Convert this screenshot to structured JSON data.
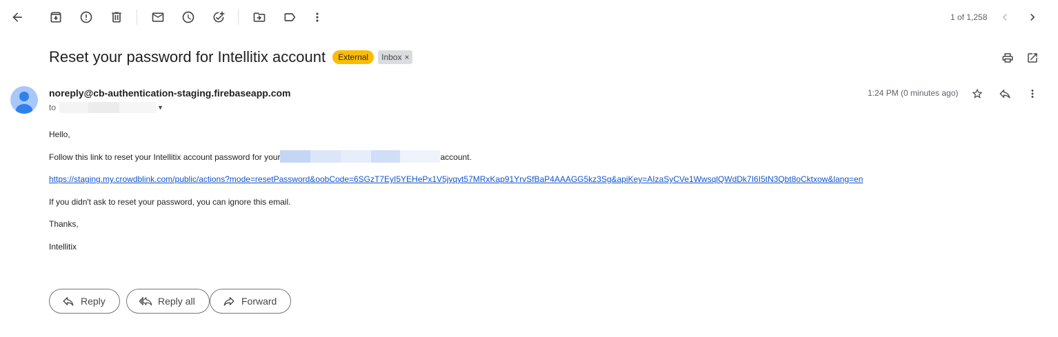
{
  "toolbar": {
    "icons": [
      "back-arrow-icon",
      "archive-icon",
      "report-spam-icon",
      "delete-icon",
      "mark-unread-icon",
      "snooze-icon",
      "add-to-tasks-icon",
      "move-to-icon",
      "labels-icon",
      "more-vert-icon"
    ],
    "pager_text": "1 of 1,258"
  },
  "message": {
    "subject": "Reset your password for Intellitix account",
    "labels": {
      "external": "External",
      "inbox": "Inbox",
      "inbox_remove": "×"
    },
    "sender": "noreply@cb-authentication-staging.firebaseapp.com",
    "to_prefix": "to",
    "timestamp": "1:24 PM (0 minutes ago)",
    "body": {
      "greeting": "Hello,",
      "line1_before": "Follow this link to reset your Intellitix account password for your",
      "line1_after": "account.",
      "link": "https://staging.my.crowdblink.com/public/actions?mode=resetPassword&oobCode=6SGzT7EyI5YEHePx1V5jyqyt57MRxKap91YrvSfBaP4AAAGG5kz3Sg&apiKey=AIzaSyCVe1WwsqlQWdDk7I6I5tN3Qbt8oCktxow&lang=en",
      "line3": "If you didn't ask to reset your password, you can ignore this email.",
      "thanks": "Thanks,",
      "signature": "Intellitix"
    }
  },
  "actions": {
    "reply": "Reply",
    "reply_all": "Reply all",
    "forward": "Forward"
  },
  "colors": {
    "external_label": "#fbbc04",
    "inbox_label": "#dadce0",
    "link": "#1155cc",
    "avatar": "#a8c7fa"
  }
}
